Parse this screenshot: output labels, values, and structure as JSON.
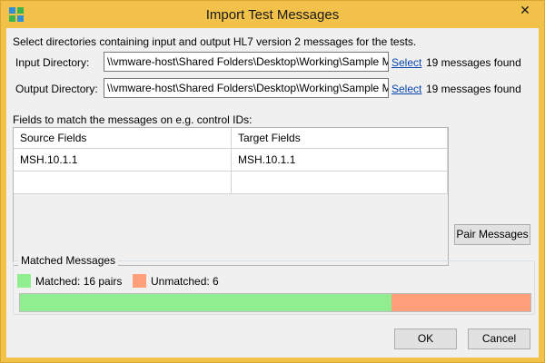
{
  "window": {
    "title": "Import Test Messages",
    "close_glyph": "✕",
    "app_icon": "app-logo-icon"
  },
  "instructions": "Select directories containing input and output HL7 version 2 messages for the tests.",
  "input_directory": {
    "label": "Input Directory:",
    "value": "\\\\vmware-host\\Shared Folders\\Desktop\\Working\\Sample Messages",
    "select_label": "Select",
    "status": "19 messages found"
  },
  "output_directory": {
    "label": "Output Directory:",
    "value": "\\\\vmware-host\\Shared Folders\\Desktop\\Working\\Sample Messages",
    "select_label": "Select",
    "status": "19 messages found"
  },
  "fields": {
    "label": "Fields to match the messages on e.g. control IDs:",
    "columns": [
      "Source Fields",
      "Target Fields"
    ],
    "rows": [
      [
        "MSH.10.1.1",
        "MSH.10.1.1"
      ],
      [
        "",
        ""
      ]
    ]
  },
  "pair_button": "Pair Messages",
  "matched": {
    "group_label": "Matched Messages",
    "matched_label": "Matched: 16 pairs",
    "unmatched_label": "Unmatched: 6",
    "matched_count": 16,
    "unmatched_count": 6,
    "colors": {
      "matched": "#90ee90",
      "unmatched": "#ffa07a"
    }
  },
  "buttons": {
    "ok": "OK",
    "cancel": "Cancel"
  }
}
